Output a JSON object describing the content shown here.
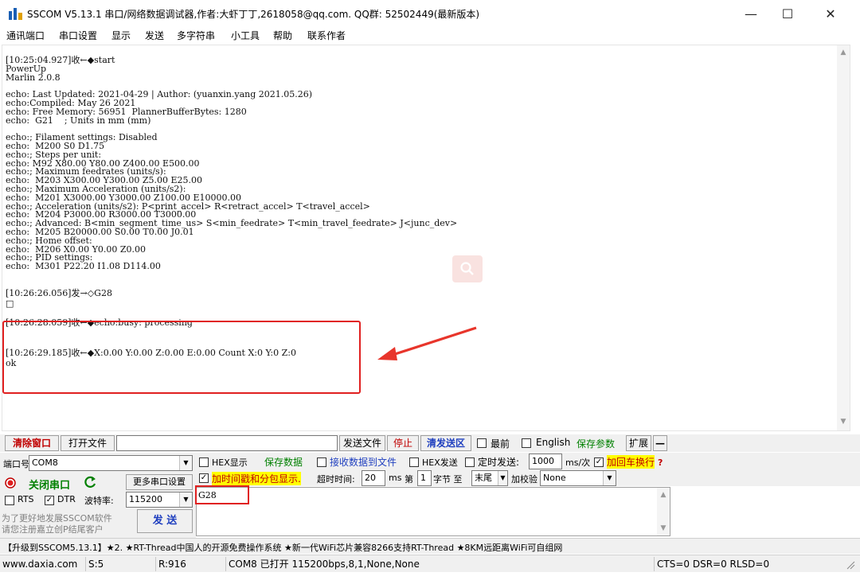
{
  "window": {
    "title": "SSCOM V5.13.1 串口/网络数据调试器,作者:大虾丁丁,2618058@qq.com. QQ群: 52502449(最新版本)"
  },
  "menu": [
    "通讯端口",
    "串口设置",
    "显示",
    "发送",
    "多字符串",
    "小工具",
    "帮助",
    "联系作者"
  ],
  "receive": {
    "lines": [
      "[10:25:04.927]收←◆start",
      "PowerUp",
      "Marlin 2.0.8",
      "",
      "echo: Last Updated: 2021-04-29 | Author: (yuanxin.yang 2021.05.26)",
      "echo:Compiled: May 26 2021",
      "echo: Free Memory: 56951  PlannerBufferBytes: 1280",
      "echo:  G21    ; Units in mm (mm)",
      "",
      "echo:; Filament settings: Disabled",
      "echo:  M200 S0 D1.75",
      "echo:; Steps per unit:",
      "echo: M92 X80.00 Y80.00 Z400.00 E500.00",
      "echo:; Maximum feedrates (units/s):",
      "echo:  M203 X300.00 Y300.00 Z5.00 E25.00",
      "echo:; Maximum Acceleration (units/s2):",
      "echo:  M201 X3000.00 Y3000.00 Z100.00 E10000.00",
      "echo:; Acceleration (units/s2): P<print_accel> R<retract_accel> T<travel_accel>",
      "echo:  M204 P3000.00 R3000.00 T3000.00",
      "echo:; Advanced: B<min_segment_time_us> S<min_feedrate> T<min_travel_feedrate> J<junc_dev>",
      "echo:  M205 B20000.00 S0.00 T0.00 J0.01",
      "echo:; Home offset:",
      "echo:  M206 X0.00 Y0.00 Z0.00",
      "echo:; PID settings:",
      "echo:  M301 P22.20 I1.08 D114.00",
      "",
      "[10:26:26.056]发→◇G28",
      "□",
      "[10:26:28.059]收←◆echo:busy: processing",
      "",
      "[10:26:29.185]收←◆X:0.00 Y:0.00 Z:0.00 E:0.00 Count X:0 Y:0 Z:0",
      "ok"
    ]
  },
  "toolbar1": {
    "clear": "清除窗口",
    "open_file": "打开文件",
    "file_path": "",
    "send_file": "发送文件",
    "stop": "停止",
    "clear_send": "清发送区",
    "topmost": "最前",
    "english": "English",
    "save_params": "保存参数",
    "expand": "扩展",
    "collapse": "—"
  },
  "port_panel": {
    "port_label": "端口号",
    "port_value": "COM8",
    "close_port": "关闭串口",
    "more_settings": "更多串口设置",
    "rts": "RTS",
    "dtr": "DTR",
    "baud_label": "波特率:",
    "baud_value": "115200",
    "promo_line1": "为了更好地发展SSCOM软件",
    "promo_line2": "请您注册嘉立创P结尾客户",
    "send": "发 送"
  },
  "options": {
    "hex_display": "HEX显示",
    "save_data": "保存数据",
    "recv_to_file": "接收数据到文件",
    "hex_send": "HEX发送",
    "timed_send": "定时发送:",
    "timed_value": "1000",
    "timed_unit": "ms/次",
    "crlf": "加回车换行",
    "timestamp": "加时间戳和分包显示.",
    "timeout_label": "超时时间:",
    "timeout_value": "20",
    "ms": "ms",
    "byte_from": "第",
    "byte_index": "1",
    "byte_to": "字节 至",
    "end_value": "末尾",
    "checksum_label": "加校验",
    "checksum_value": "None"
  },
  "send_box": {
    "value": "G28"
  },
  "status_line": "【升级到SSCOM5.13.1】★2. ★RT-Thread中国人的开源免费操作系统 ★新一代WiFi芯片兼容8266支持RT-Thread ★8KM远距离WiFi可自组网",
  "bottom": {
    "site": "www.daxia.com",
    "s": "S:5",
    "r": "R:916",
    "port_status": "COM8 已打开  115200bps,8,1,None,None",
    "signals": "CTS=0 DSR=0 RLSD=0"
  },
  "colors": {
    "accent_red": "#e02020",
    "send_green": "#008000",
    "highlight_yellow": "#ffff00"
  }
}
